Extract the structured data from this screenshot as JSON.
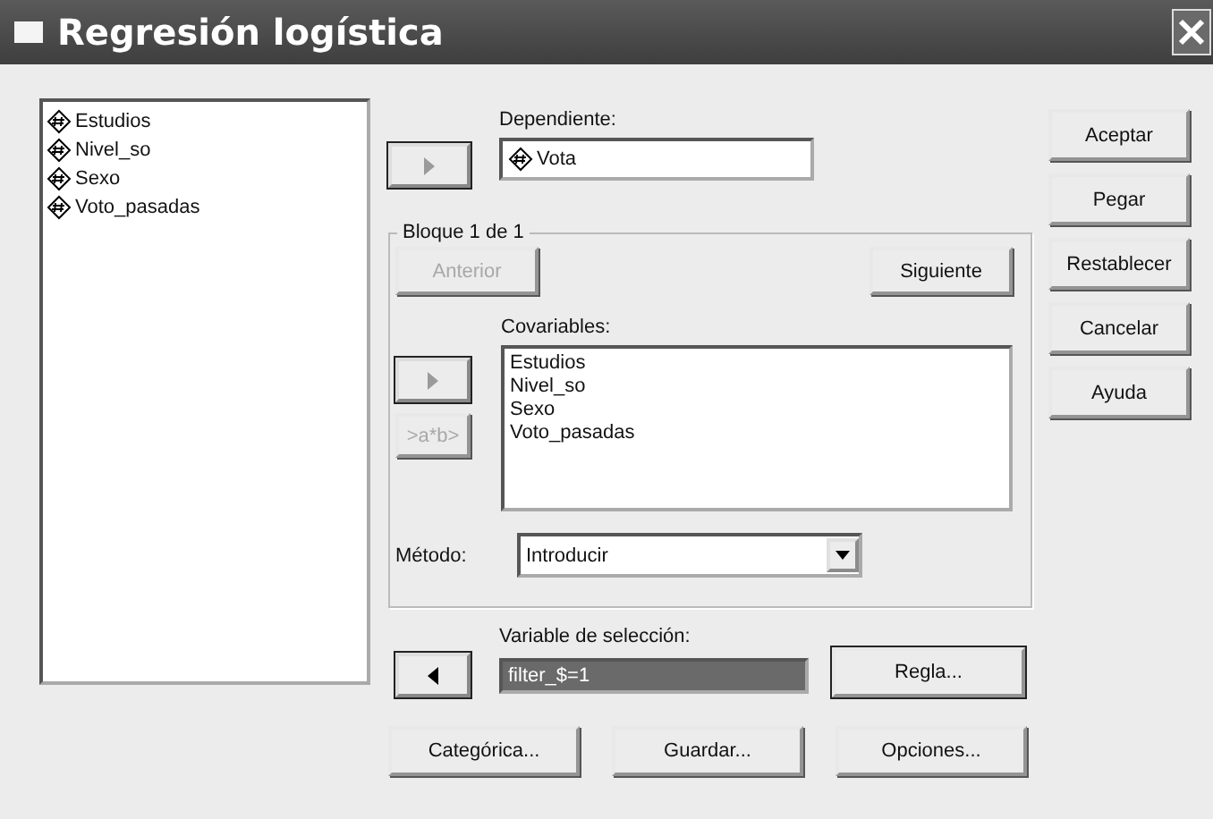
{
  "window": {
    "title": "Regresión logística"
  },
  "variables": [
    {
      "name": "Estudios",
      "kind": "scale"
    },
    {
      "name": "Nivel_so",
      "kind": "scale"
    },
    {
      "name": "Sexo",
      "kind": "scale"
    },
    {
      "name": "Voto_pasadas",
      "kind": "scale"
    }
  ],
  "dependent": {
    "label": "Dependiente:",
    "arrow": {
      "kind": "right",
      "disabled": true
    },
    "value": {
      "name": "Vota",
      "kind": "scale"
    }
  },
  "block": {
    "title": "Bloque 1 de 1",
    "previous": {
      "label": "Anterior",
      "disabled": true
    },
    "next": {
      "label": "Siguiente",
      "disabled": false
    },
    "covariates_label": "Covariables:",
    "arrow": {
      "kind": "right",
      "disabled": true
    },
    "interaction": {
      "label": ">a*b>",
      "disabled": true
    },
    "covariates": [
      "Estudios",
      "Nivel_so",
      "Sexo",
      "Voto_pasadas"
    ],
    "method_label": "Método:",
    "method": "Introducir"
  },
  "selection": {
    "label": "Variable de selección:",
    "arrow": {
      "kind": "left",
      "disabled": false
    },
    "value": "filter_$=1",
    "selected": true,
    "rule_button": "Regla..."
  },
  "bottom_buttons": [
    "Categórica...",
    "Guardar...",
    "Opciones..."
  ],
  "side_buttons": [
    "Aceptar",
    "Pegar",
    "Restablecer",
    "Cancelar",
    "Ayuda"
  ]
}
